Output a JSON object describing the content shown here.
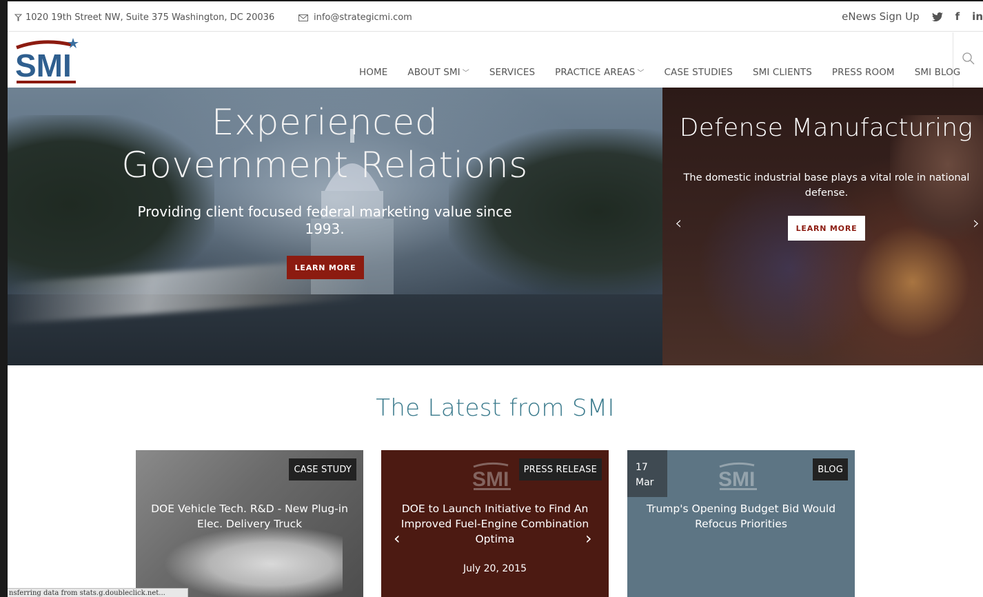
{
  "topbar": {
    "address": "1020 19th Street NW, Suite 375 Washington, DC 20036",
    "email": "info@strategicmi.com",
    "enews": "eNews Sign Up",
    "social": [
      "twitter-icon",
      "facebook-icon",
      "linkedin-icon"
    ]
  },
  "logo": {
    "text": "SMI"
  },
  "nav": {
    "items": [
      {
        "label": "HOME"
      },
      {
        "label": "ABOUT SMI"
      },
      {
        "label": "SERVICES"
      },
      {
        "label": "PRACTICE AREAS"
      },
      {
        "label": "CASE STUDIES"
      },
      {
        "label": "SMI CLIENTS"
      },
      {
        "label": "PRESS ROOM"
      },
      {
        "label": "SMI BLOG"
      }
    ]
  },
  "hero": {
    "left": {
      "title_line1": "Experienced",
      "title_line2": "Government Relations",
      "subtitle": "Providing client focused federal marketing value since 1993.",
      "button": "LEARN MORE"
    },
    "right": {
      "title": "Defense Manufacturing",
      "text": "The domestic industrial base plays a vital role in national defense.",
      "button": "LEARN MORE"
    }
  },
  "latest": {
    "title": "The Latest from SMI",
    "cards": [
      {
        "tag": "CASE STUDY",
        "title": "DOE Vehicle Tech. R&D - New Plug-in Elec. Delivery Truck"
      },
      {
        "tag": "PRESS RELEASE",
        "title": "DOE to Launch Initiative to Find An Improved Fuel-Engine Combination Optima",
        "date": "July 20, 2015"
      },
      {
        "tag": "BLOG",
        "title": "Trump's Opening Budget Bid Would Refocus Priorities",
        "day": "17",
        "month": "Mar"
      }
    ]
  },
  "status": "nsferring data from stats.g.doubleclick.net...",
  "colors": {
    "brand_red": "#8c1b10",
    "heading_teal": "#3a7a8c",
    "card_maroon": "#4c1a12",
    "card_slate": "#5d7584"
  }
}
